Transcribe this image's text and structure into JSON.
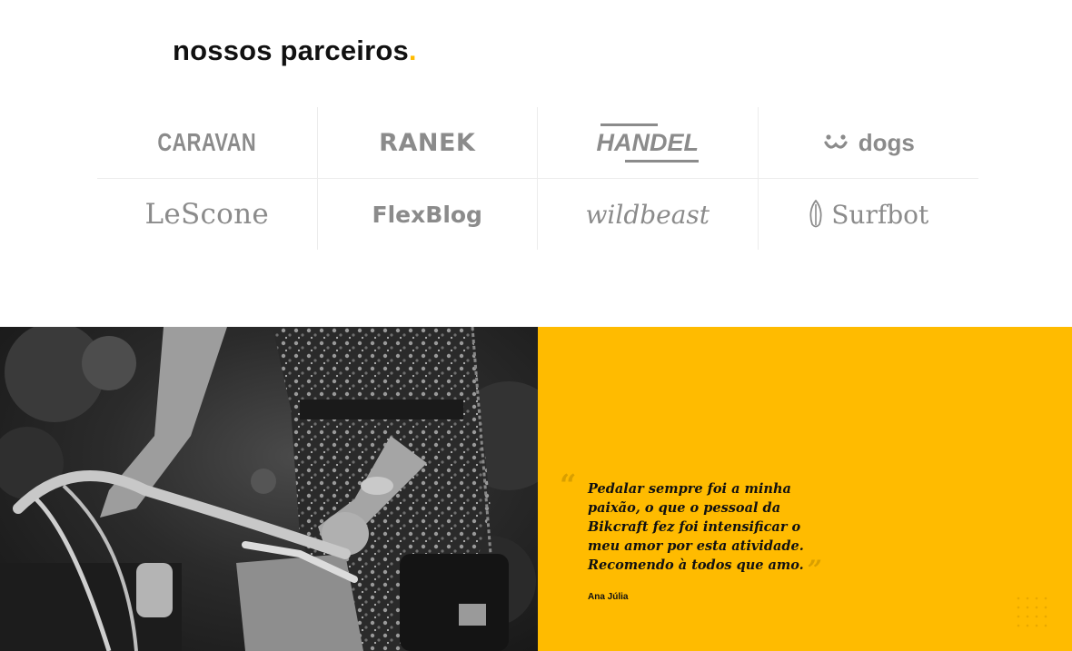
{
  "partners": {
    "title": "nossos parceiros",
    "title_dot": ".",
    "logos": [
      {
        "name": "CARAVAN",
        "icon": "caravan-logo"
      },
      {
        "name": "RANEK",
        "icon": "ranek-logo"
      },
      {
        "name": "HANDEL",
        "icon": "handel-logo"
      },
      {
        "name": "dogs",
        "icon": "dogs-face-icon"
      },
      {
        "name": "LeScone",
        "icon": "lescone-logo"
      },
      {
        "name": "FlexBlog",
        "icon": "flexblog-logo"
      },
      {
        "name": "wildbeast",
        "icon": "wildbeast-logo"
      },
      {
        "name": "Surfbot",
        "icon": "surfboard-icon"
      }
    ]
  },
  "testimonial": {
    "quote": "Pedalar sempre foi a minha paixão, o que o pessoal da Bikcraft fez foi intensificar o meu amor por esta atividade. Recomendo à todos que amo.",
    "open_mark": "“",
    "close_mark": "”",
    "author": "Ana Júlia",
    "photo_icon": "cyclist-photo"
  },
  "colors": {
    "accent": "#ffbb00",
    "logo_gray": "#8b8b8b",
    "text": "#111111"
  }
}
